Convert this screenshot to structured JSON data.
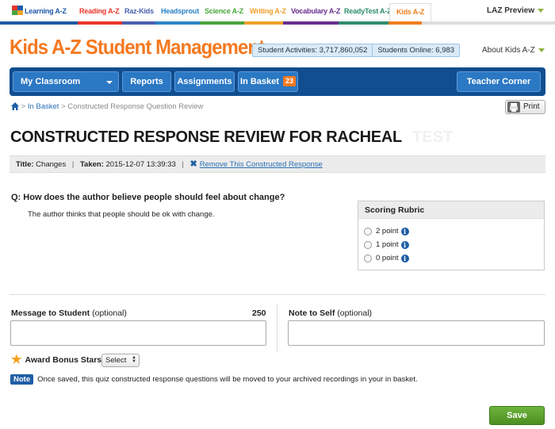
{
  "product_bar": {
    "items": [
      {
        "label": "Learning A-Z",
        "color": "#1e5aa6"
      },
      {
        "label": "Reading A-Z",
        "color": "#e8352b"
      },
      {
        "label": "Raz-Kids",
        "color": "#4a5fb0"
      },
      {
        "label": "Headsprout",
        "color": "#2a84c7"
      },
      {
        "label": "Science A-Z",
        "color": "#49a43c"
      },
      {
        "label": "Writing A-Z",
        "color": "#f0a02b"
      },
      {
        "label": "Vocabulary A-Z",
        "color": "#6a2e8e"
      },
      {
        "label": "ReadyTest A-Z",
        "color": "#2e8d6d"
      },
      {
        "label": "Kids A-Z",
        "color": "#f07d1b"
      }
    ],
    "active": "Kids A-Z",
    "preview_label": "LAZ Preview"
  },
  "header": {
    "title": "Kids A-Z Student Management",
    "student_activities": "Student Activities: 3,717,860,052",
    "students_online": "Students Online: 6,983",
    "about_label": "About Kids A-Z"
  },
  "nav": {
    "my_classroom": "My Classroom",
    "reports": "Reports",
    "assignments": "Assignments",
    "in_basket": "In Basket",
    "in_basket_count": "23",
    "teacher_corner": "Teacher Corner"
  },
  "breadcrumb": {
    "separator": ">",
    "link": "In Basket",
    "current": "Constructed Response Question Review"
  },
  "print_label": "Print",
  "page_title": "CONSTRUCTED RESPONSE REVIEW FOR RACHEAL",
  "ghost_title": "TEST",
  "info": {
    "title_label": "Title:",
    "title_value": "Changes",
    "taken_label": "Taken:",
    "taken_value": "2015-12-07 13:39:33",
    "remove_link": "Remove This Constructed Response"
  },
  "question": "Q: How does the author believe people should feel about change?",
  "answer": "The author thinks that people should be ok with change.",
  "rubric": {
    "heading": "Scoring Rubric",
    "options": [
      "2 point",
      "1 point",
      "0 point"
    ]
  },
  "message": {
    "label": "Message to Student",
    "optional": "(optional)",
    "remaining": "250"
  },
  "note_to_self": {
    "label": "Note to Self",
    "optional": "(optional)"
  },
  "bonus": {
    "label": "Award Bonus Stars",
    "select_value": "Select"
  },
  "note": {
    "tag": "Note",
    "text": "Once saved, this quiz constructed response questions will be moved to your archived recordings in your in basket."
  },
  "save_label": "Save",
  "colors": {
    "accent_orange": "#f47920",
    "nav_blue": "#104e90",
    "button_blue": "#2b78c4",
    "save_green": "#5aa02f",
    "link_blue": "#2a6fb5"
  }
}
